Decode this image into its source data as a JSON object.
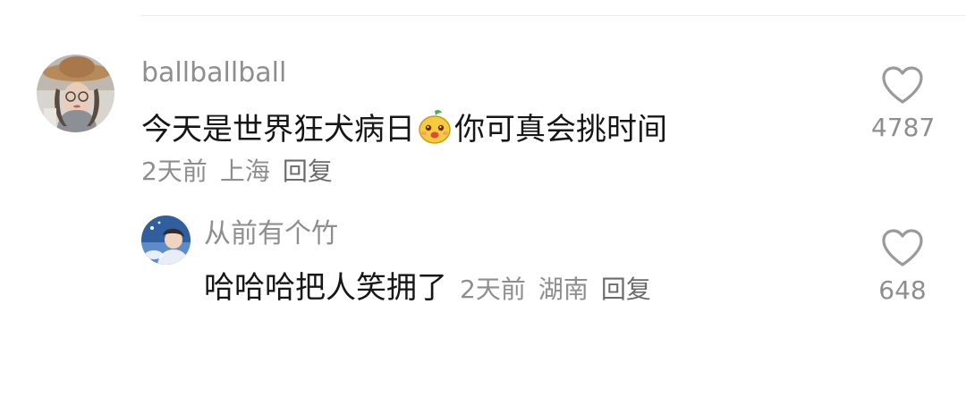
{
  "comments": [
    {
      "username": "ballballball",
      "text_before": "今天是世界狂犬病日",
      "emoji": "yellow-pear-emoji",
      "text_after": "你可真会挑时间",
      "time": "2天前",
      "location": "上海",
      "reply": "回复",
      "likes": "4787"
    },
    {
      "username": "从前有个竹",
      "text": "哈哈哈把人笑拥了",
      "time": "2天前",
      "location": "湖南",
      "reply": "回复",
      "likes": "648"
    }
  ],
  "icons": {
    "like": "heart-outline-icon"
  },
  "colors": {
    "username": "#8e8e8e",
    "text": "#161616",
    "meta": "#8e8e8e",
    "heart": "#9a9a9a"
  }
}
